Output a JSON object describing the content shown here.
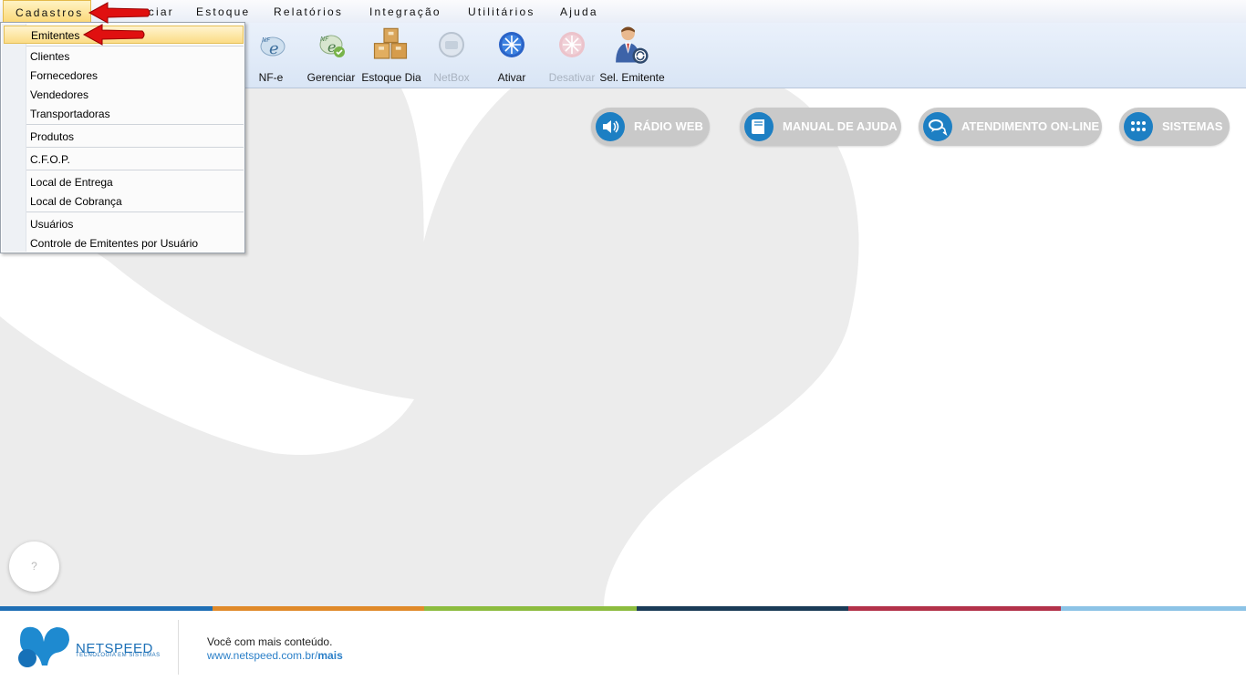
{
  "menu": {
    "items": [
      "Cadastros",
      "Gerenciar",
      "Estoque",
      "Relatórios",
      "Integração",
      "Utilitários",
      "Ajuda"
    ],
    "visible_partial": "enciar"
  },
  "toolbar": {
    "buttons": [
      {
        "label": "NF-e",
        "icon": "nfe-icon",
        "enabled": true
      },
      {
        "label": "Gerenciar",
        "icon": "nfe-manage-icon",
        "enabled": true
      },
      {
        "label": "Estoque Dia",
        "icon": "boxes-icon",
        "enabled": true
      },
      {
        "label": "NetBox",
        "icon": "netbox-icon",
        "enabled": false
      },
      {
        "label": "Ativar",
        "icon": "activate-icon",
        "enabled": true
      },
      {
        "label": "Desativar",
        "icon": "deactivate-icon",
        "enabled": false
      },
      {
        "label": "Sel. Emitente",
        "icon": "user-select-icon",
        "enabled": true
      }
    ]
  },
  "quick_links": [
    {
      "label": "RÁDIO WEB",
      "icon": "speaker-icon"
    },
    {
      "label": "MANUAL DE AJUDA",
      "icon": "book-icon"
    },
    {
      "label": "ATENDIMENTO ON-LINE",
      "icon": "chat-icon"
    },
    {
      "label": "SISTEMAS",
      "icon": "grid-icon"
    }
  ],
  "help_button": "?",
  "dropdown": {
    "items": [
      {
        "label": "Emitentes",
        "highlighted": true
      },
      {
        "label": "Clientes"
      },
      {
        "label": "Fornecedores"
      },
      {
        "label": "Vendedores"
      },
      {
        "label": "Transportadoras"
      },
      {
        "label": "Produtos"
      },
      {
        "label": "C.F.O.P."
      },
      {
        "label": "Local de Entrega"
      },
      {
        "label": "Local de Cobrança"
      },
      {
        "label": "Usuários"
      },
      {
        "label": "Controle de Emitentes por Usuário"
      }
    ]
  },
  "footer": {
    "brand": "NETSPEED",
    "tagline": "TECNOLOGIA EM SISTEMAS",
    "line1": "Você com mais conteúdo.",
    "url_prefix": "www.netspeed.com.br/",
    "url_suffix": "mais"
  },
  "colors": {
    "accent_blue": "#1d7fc3",
    "pill_gray": "#c9c9c9",
    "stripe": [
      "#1f6fb5",
      "#e08a2a",
      "#8cbc3f",
      "#1b3b57",
      "#b3324a",
      "#8cc3e6"
    ],
    "arrow_red": "#e01010"
  }
}
